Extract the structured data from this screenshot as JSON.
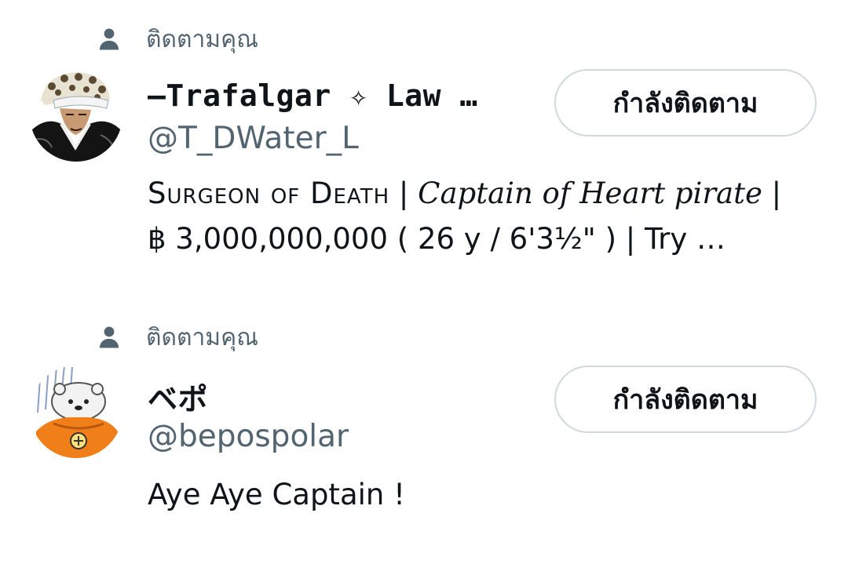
{
  "users": [
    {
      "follows_you_label": "ติดตามคุณ",
      "display_name": "—Trafalgar ✧ Law …",
      "handle": "@T_DWater_L",
      "bio_line1_part1": "Surgeon of Death",
      "bio_line1_sep1": " | ",
      "bio_line1_part2": "Captain of Heart pirate",
      "bio_line1_sep2": " |",
      "bio_line2": "฿ 3,000,000,000 ( 26 y / 6'3½\" ) | Try …",
      "button_label": "กำลังติดตาม",
      "avatar_icon": "trafalgar-law-avatar"
    },
    {
      "follows_you_label": "ติดตามคุณ",
      "display_name": "ベポ",
      "handle": "@bepospolar",
      "bio_line1": "Aye Aye Captain !",
      "button_label": "กำลังติดตาม",
      "avatar_icon": "bepo-avatar"
    }
  ],
  "colors": {
    "secondary_text": "#536471",
    "primary_text": "#0f1419",
    "button_border": "#cfd9de"
  }
}
